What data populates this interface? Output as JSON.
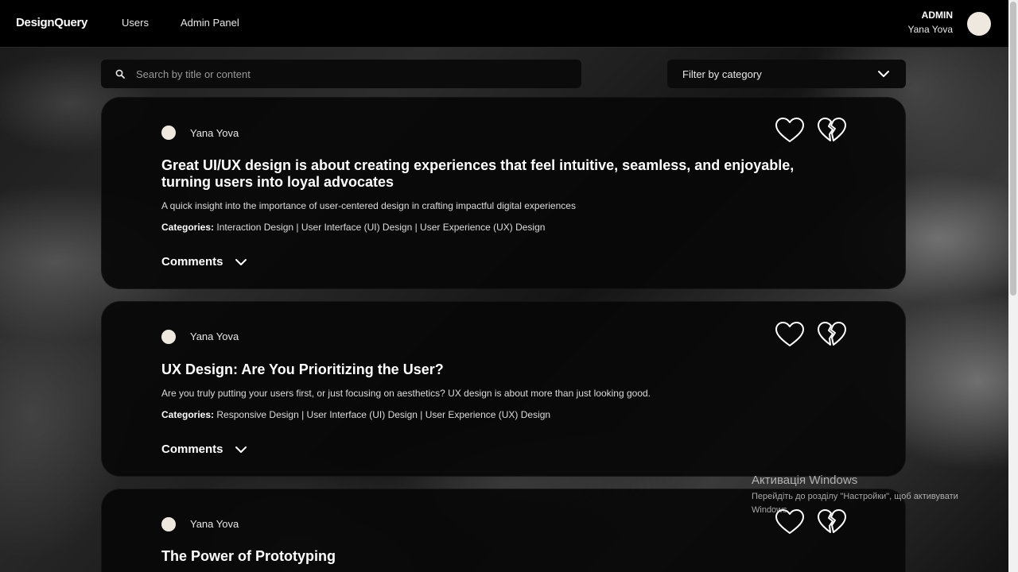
{
  "header": {
    "logo": "DesignQuery",
    "nav": [
      "Users",
      "Admin Panel"
    ],
    "user_role": "ADMIN",
    "user_name": "Yana Yova"
  },
  "search": {
    "placeholder": "Search by title or content",
    "value": ""
  },
  "filter": {
    "label": "Filter by category"
  },
  "posts": [
    {
      "author": "Yana Yova",
      "title": "Great UI/UX design is about creating experiences that feel intuitive, seamless, and enjoyable, turning users into loyal advocates",
      "description": "A quick insight into the importance of user-centered design in crafting impactful digital experiences",
      "categories_label": "Categories:",
      "categories": "Interaction Design | User Interface (UI) Design | User Experience (UX) Design",
      "comments_label": "Comments"
    },
    {
      "author": "Yana Yova",
      "title": "UX Design: Are You Prioritizing the User?",
      "description": "Are you truly putting your users first, or just focusing on aesthetics? UX design is about more than just looking good.",
      "categories_label": "Categories:",
      "categories": "Responsive Design | User Interface (UI) Design | User Experience (UX) Design",
      "comments_label": "Comments"
    },
    {
      "author": "Yana Yova",
      "title": "The Power of Prototyping"
    }
  ],
  "icons": {
    "like": "heart-outline-icon",
    "dislike": "broken-heart-icon",
    "search": "search-icon",
    "chevron": "chevron-down-icon"
  },
  "os_overlay": {
    "title": "Активація Windows",
    "subtitle": "Перейдіть до розділу \"Настройки\", щоб активувати Windows."
  }
}
